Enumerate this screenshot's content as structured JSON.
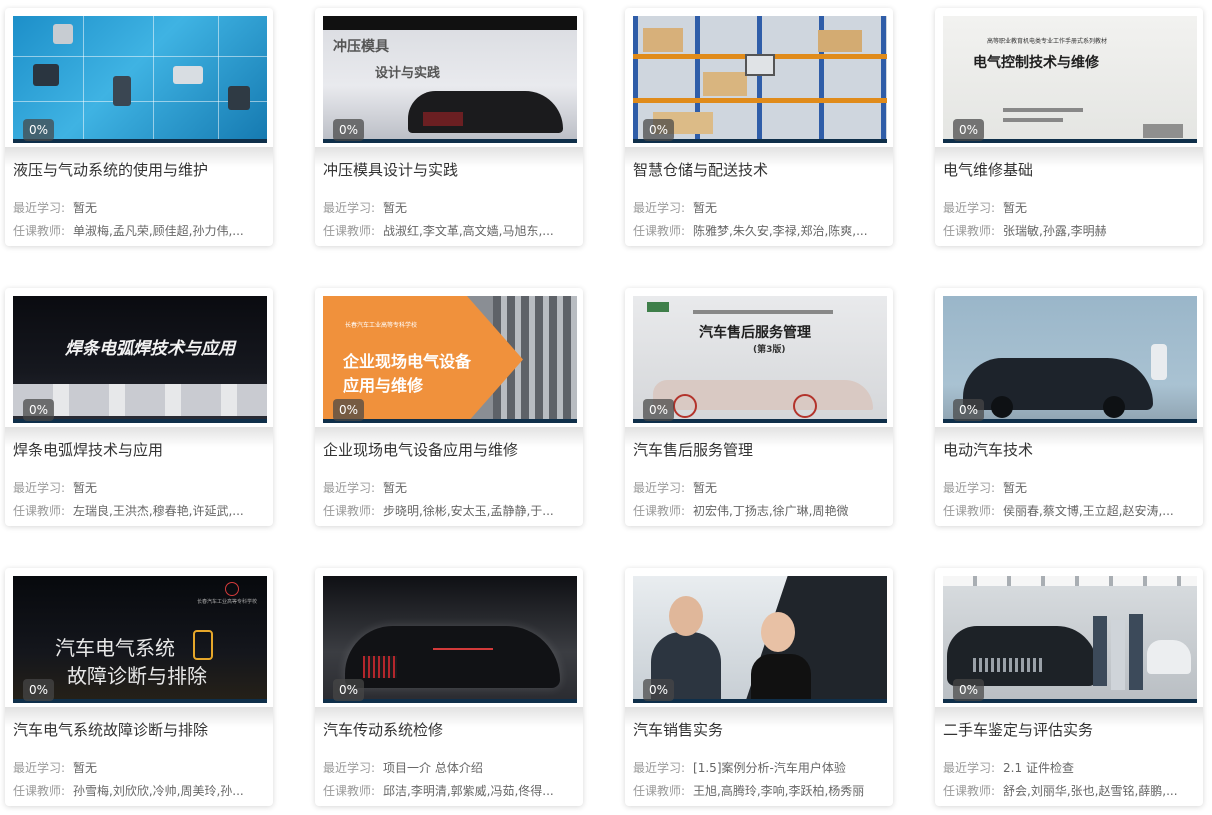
{
  "labels": {
    "recent": "最近学习:",
    "teacher": "任课教师:"
  },
  "courses": [
    {
      "title": "液压与气动系统的使用与维护",
      "progress": "0%",
      "recent": "暂无",
      "teachers": "单淑梅,孟凡荣,顾佳超,孙力伟,..."
    },
    {
      "title": "冲压模具设计与实践",
      "progress": "0%",
      "recent": "暂无",
      "teachers": "战淑红,李文革,高文嫱,马旭东,..."
    },
    {
      "title": "智慧仓储与配送技术",
      "progress": "0%",
      "recent": "暂无",
      "teachers": "陈雅梦,朱久安,李禄,郑治,陈爽,..."
    },
    {
      "title": "电气维修基础",
      "progress": "0%",
      "recent": "暂无",
      "teachers": "张瑞敏,孙露,李明赫"
    },
    {
      "title": "焊条电弧焊技术与应用",
      "progress": "0%",
      "recent": "暂无",
      "teachers": "左瑞良,王洪杰,穆春艳,许延武,..."
    },
    {
      "title": "企业现场电气设备应用与维修",
      "progress": "0%",
      "recent": "暂无",
      "teachers": "步晓明,徐彬,安太玉,孟静静,于..."
    },
    {
      "title": "汽车售后服务管理",
      "progress": "0%",
      "recent": "暂无",
      "teachers": "初宏伟,丁扬志,徐广琳,周艳微"
    },
    {
      "title": "电动汽车技术",
      "progress": "0%",
      "recent": "暂无",
      "teachers": "侯丽春,蔡文博,王立超,赵安涛,..."
    },
    {
      "title": "汽车电气系统故障诊断与排除",
      "progress": "0%",
      "recent": "暂无",
      "teachers": "孙雪梅,刘欣欣,冷帅,周美玲,孙..."
    },
    {
      "title": "汽车传动系统检修",
      "progress": "0%",
      "recent": "项目一介 总体介绍",
      "teachers": "邱洁,李明清,郭紫威,冯茹,佟得..."
    },
    {
      "title": "汽车销售实务",
      "progress": "0%",
      "recent": "[1.5]案例分析-汽车用户体验",
      "teachers": "王旭,高腾玲,李响,李跃柏,杨秀丽"
    },
    {
      "title": "二手车鉴定与评估实务",
      "progress": "0%",
      "recent": "2.1 证件检查",
      "teachers": "舒会,刘丽华,张也,赵雪铭,薛鹏,..."
    }
  ],
  "thumbnails": {
    "stamping": {
      "line1": "冲压模具",
      "line2": "设计与实践"
    },
    "electrical_book": {
      "header": "高等职业教育机电类专业工作手册式系列教材",
      "title": "电气控制技术与维修"
    },
    "welding": {
      "text": "焊条电弧焊技术与应用"
    },
    "field_electrical": {
      "school": "长春汽车工业高等专科学校",
      "line1": "企业现场电气设备",
      "line2": "应用与维修"
    },
    "aftersales_book": {
      "title": "汽车售后服务管理",
      "edition": "(第3版)"
    },
    "auto_electrical": {
      "school": "长春汽车工业高等专科学校",
      "line1": "汽车电气系统",
      "line2": "故障诊断与排除"
    }
  },
  "colors": {
    "accent_bar": "#0f2f4a",
    "title": "#333333",
    "label": "#9a9a9a",
    "value": "#666666",
    "orange": "#f0913c"
  }
}
